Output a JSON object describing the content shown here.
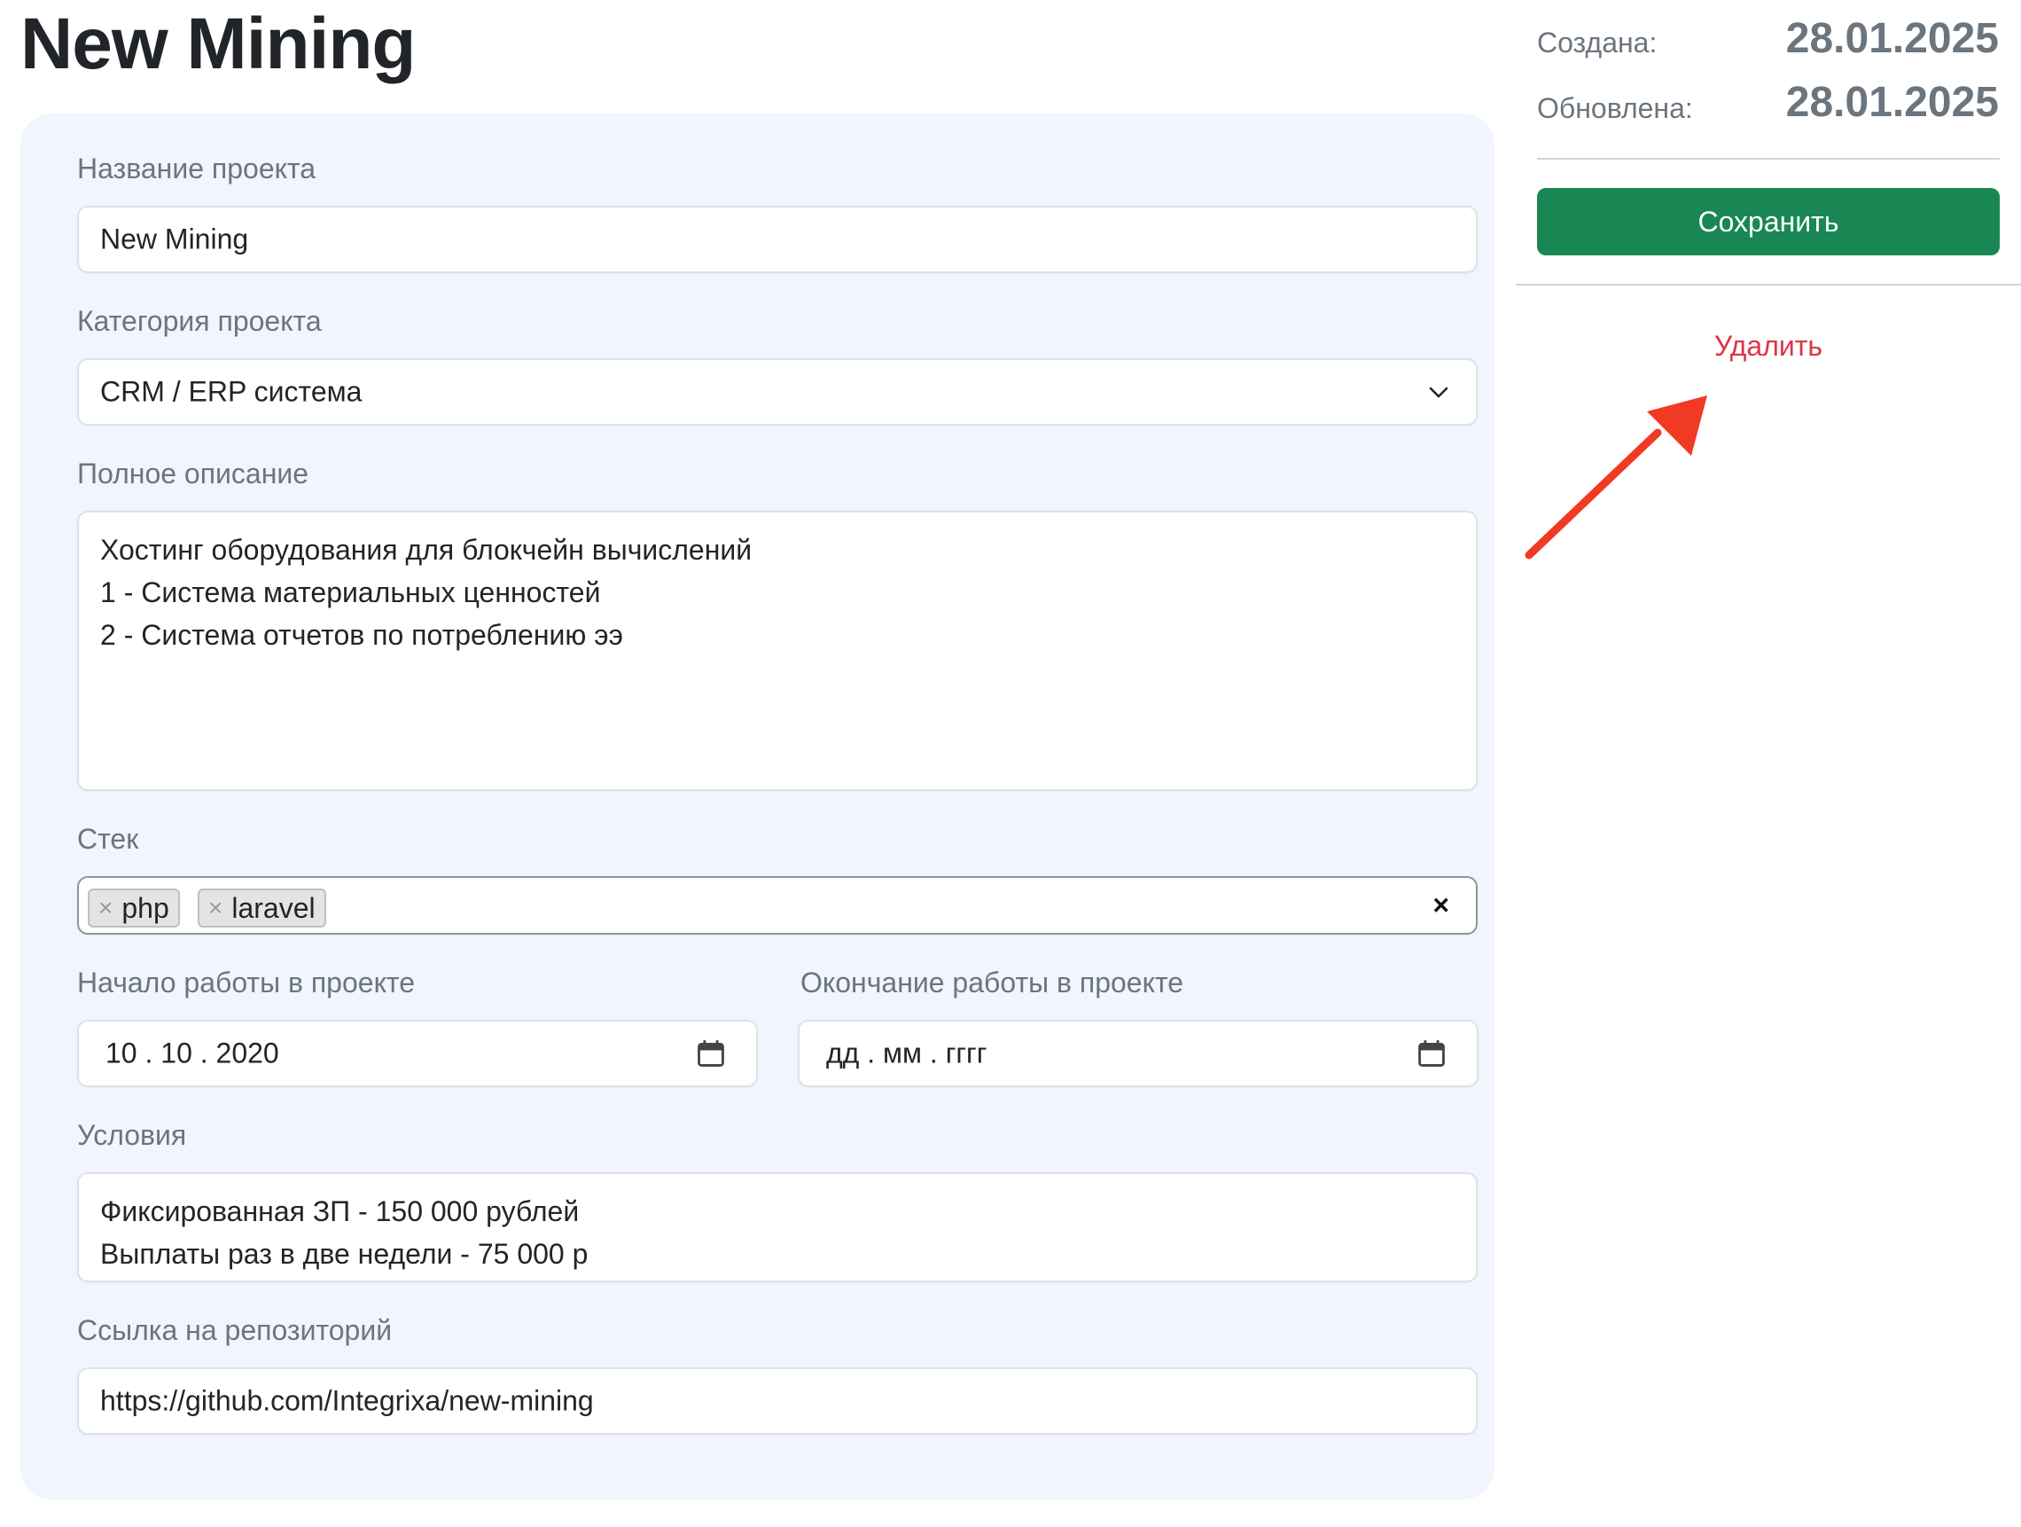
{
  "title": "New Mining",
  "meta": {
    "created_label": "Создана:",
    "created_value": "28.01.2025",
    "updated_label": "Обновлена:",
    "updated_value": "28.01.2025"
  },
  "actions": {
    "save_label": "Сохранить",
    "delete_label": "Удалить"
  },
  "form": {
    "name_label": "Название проекта",
    "name_value": "New Mining",
    "category_label": "Категория проекта",
    "category_value": "CRM / ERP система",
    "description_label": "Полное описание",
    "description_lines": [
      "Хостинг оборудования для блокчейн вычислений",
      "1 - Система материальных ценностей",
      "2 - Система отчетов по потреблению ээ"
    ],
    "stack_label": "Стек",
    "stack_tags": [
      "php",
      "laravel"
    ],
    "start_label": "Начало работы в проекте",
    "start_value": "10 . 10 . 2020",
    "end_label": "Окончание работы в проекте",
    "end_placeholder": "дд . мм . гггг",
    "conditions_label": "Условия",
    "conditions_lines": [
      "Фиксированная ЗП - 150 000 рублей",
      "Выплаты раз в две недели - 75 000 р"
    ],
    "repo_label": "Ссылка на репозиторий",
    "repo_value": "https://github.com/Integrixa/new-mining"
  },
  "colors": {
    "save_button": "#198754",
    "delete_link": "#dc3545",
    "annotation_arrow": "#f03a24",
    "card_background": "#f0f5fe"
  },
  "icons": {
    "category_select": "chevron-down-icon",
    "date_fields": "calendar-icon",
    "tag_remove": "remove-tag-icon",
    "stack_clear": "clear-icon",
    "annotation": "red-arrow-annotation"
  }
}
